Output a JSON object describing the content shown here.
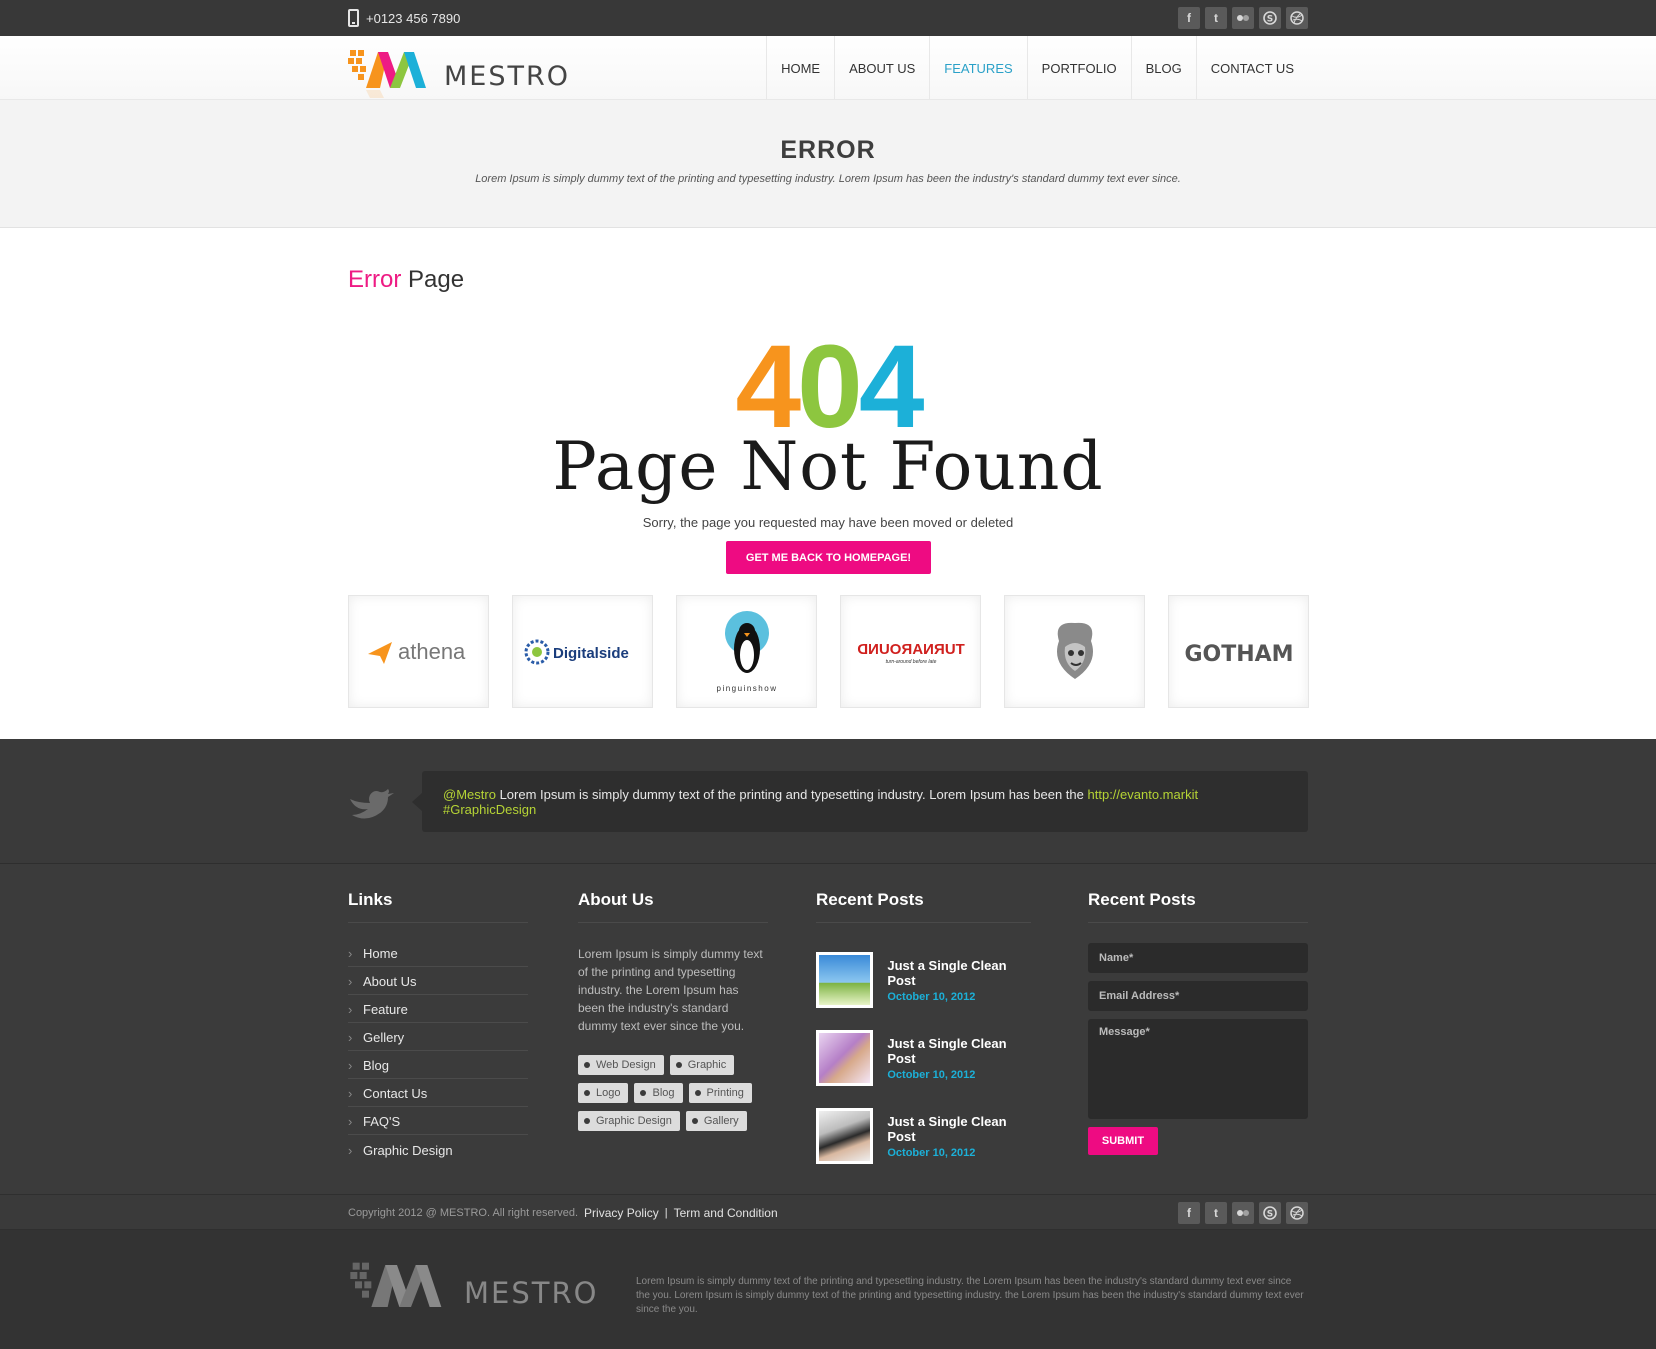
{
  "topbar": {
    "phone": "+0123 456 7890",
    "socials": [
      "facebook-icon",
      "twitter-icon",
      "flickr-icon",
      "skype-icon",
      "dribbble-icon"
    ]
  },
  "header": {
    "logo_text": "MESTRO",
    "nav": [
      "HOME",
      "ABOUT US",
      "FEATURES",
      "PORTFOLIO",
      "BLOG",
      "CONTACT US"
    ],
    "active_nav": "FEATURES"
  },
  "banner": {
    "title": "ERROR",
    "subtitle": "Lorem Ipsum is simply dummy text of the printing and typesetting industry. Lorem Ipsum has been the industry's standard dummy text ever since."
  },
  "main": {
    "title_accent": "Error",
    "title_rest": "Page",
    "code_digits": [
      "4",
      "0",
      "4"
    ],
    "headline": "Page Not Found",
    "message": "Sorry, the page you requested may have been moved or deleted",
    "button": "GET ME BACK TO HOMEPAGE!",
    "clients": [
      "athena",
      "Digitalside",
      "pinguinshow",
      "TURNAROUND",
      "",
      "GOTHAM"
    ],
    "clients_sub": [
      "",
      "",
      "",
      "turn-around before late",
      "",
      ""
    ]
  },
  "tweet": {
    "handle": "@Mestro",
    "text": "Lorem Ipsum is simply dummy text of the printing and typesetting industry. Lorem Ipsum has been the",
    "link": "http://evanto.markit",
    "hashtag": "#GraphicDesign"
  },
  "footer": {
    "links_title": "Links",
    "links": [
      "Home",
      "About Us",
      "Feature",
      "Gellery",
      "Blog",
      "Contact Us",
      "FAQ'S",
      "Graphic Design"
    ],
    "about_title": "About Us",
    "about_text": "Lorem Ipsum is simply dummy text of the printing and typesetting industry. the Lorem Ipsum has been the industry's standard dummy text ever since the you.",
    "tags": [
      "Web Design",
      "Graphic",
      "Logo",
      "Blog",
      "Printing",
      "Graphic Design",
      "Gallery"
    ],
    "posts_title": "Recent Posts",
    "posts": [
      {
        "title": "Just a Single Clean Post",
        "date": "October 10, 2012"
      },
      {
        "title": "Just a Single Clean Post",
        "date": "October 10, 2012"
      },
      {
        "title": "Just a Single Clean Post",
        "date": "October 10, 2012"
      }
    ],
    "form_title": "Recent Posts",
    "form": {
      "name": "Name*",
      "email": "Email Address*",
      "message": "Message*",
      "submit": "SUBMIT"
    }
  },
  "copyright": {
    "text": "Copyright 2012 @ MESTRO. All right reserved.",
    "privacy": "Privacy Policy",
    "separator": "|",
    "terms": "Term and Condition"
  },
  "bottom": {
    "logo_text": "MESTRO",
    "text": "Lorem Ipsum is simply dummy text of the printing and typesetting industry. the Lorem Ipsum has been the industry's standard dummy text ever since the you. Lorem Ipsum is simply dummy text of the printing and typesetting industry. the Lorem Ipsum has been the industry's standard dummy text ever since the you."
  },
  "colors": {
    "accent_pink": "#ee0b82",
    "orange": "#f7941d",
    "green": "#8dc63f",
    "blue": "#1cb0d8",
    "tweet_highlight": "#b5d335",
    "dark": "#3b3b3b"
  }
}
